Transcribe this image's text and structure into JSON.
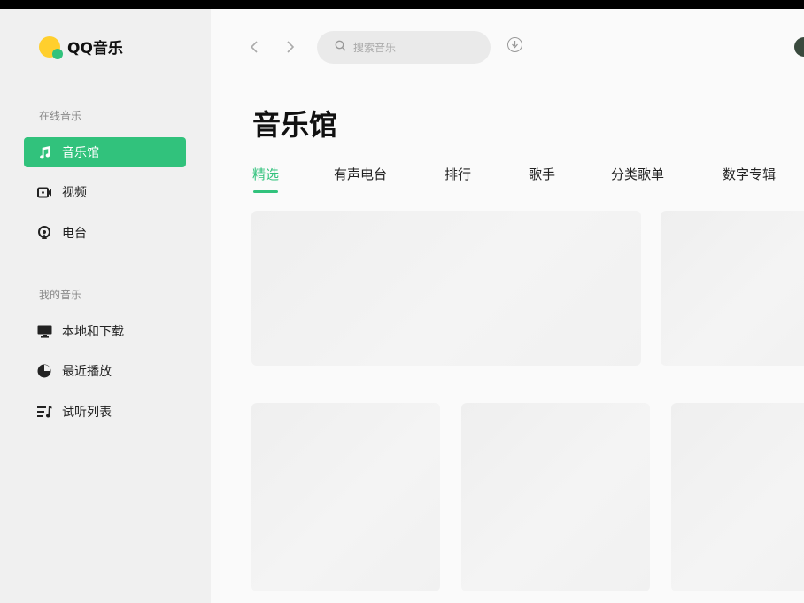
{
  "app": {
    "name": "QQ音乐"
  },
  "sidebar": {
    "online_title": "在线音乐",
    "online_items": [
      {
        "label": "音乐馆",
        "icon": "music-note-icon",
        "active": true
      },
      {
        "label": "视频",
        "icon": "video-icon",
        "active": false
      },
      {
        "label": "电台",
        "icon": "radio-icon",
        "active": false
      }
    ],
    "mine_title": "我的音乐",
    "mine_items": [
      {
        "label": "本地和下载",
        "icon": "computer-icon"
      },
      {
        "label": "最近播放",
        "icon": "clock-icon"
      },
      {
        "label": "试听列表",
        "icon": "playlist-icon"
      }
    ]
  },
  "topbar": {
    "back_icon": "chevron-left-icon",
    "forward_icon": "chevron-right-icon",
    "search_placeholder": "搜索音乐",
    "listen_icon": "music-recognition-icon"
  },
  "main": {
    "title": "音乐馆",
    "tabs": [
      {
        "label": "精选",
        "active": true
      },
      {
        "label": "有声电台"
      },
      {
        "label": "排行"
      },
      {
        "label": "歌手"
      },
      {
        "label": "分类歌单"
      },
      {
        "label": "数字专辑"
      }
    ]
  },
  "colors": {
    "accent": "#31c27c",
    "sidebar_bg": "#f0f0f0",
    "content_bg": "#fafafa"
  }
}
